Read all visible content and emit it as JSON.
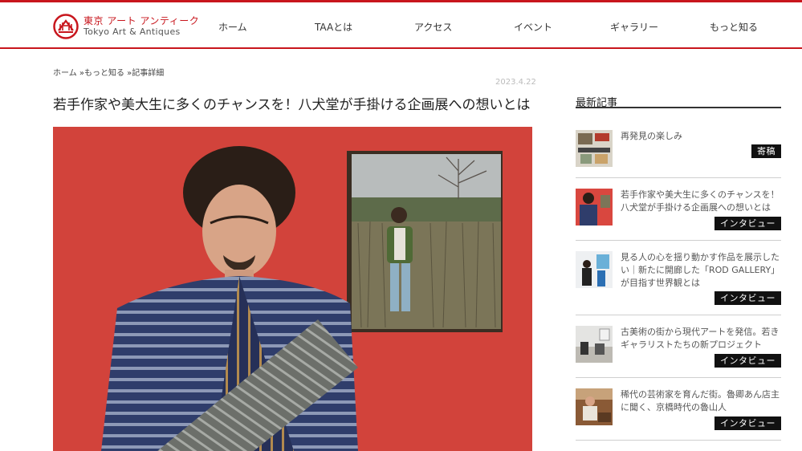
{
  "header": {
    "logo_line1": "東京 アート アンティーク",
    "logo_line2": "Tokyo Art & Antiques",
    "nav": [
      "ホーム",
      "TAAとは",
      "アクセス",
      "イベント",
      "ギャラリー",
      "もっと知る"
    ]
  },
  "breadcrumb": "ホーム »もっと知る »記事詳細",
  "article": {
    "date": "2023.4.22",
    "title": "若手作家や美大生に多くのチャンスを！八犬堂が手掛ける企画展への想いとは"
  },
  "sidebar": {
    "heading": "最新記事",
    "items": [
      {
        "title": "再発見の楽しみ",
        "badge": "寄稿"
      },
      {
        "title": "若手作家や美大生に多くのチャンスを！八犬堂が手掛ける企画展への想いとは",
        "badge": "インタビュー"
      },
      {
        "title": "見る人の心を揺り動かす作品を展示したい｜新たに開廊した「ROD GALLERY」が目指す世界観とは",
        "badge": "インタビュー"
      },
      {
        "title": "古美術の街から現代アートを発信。若きギャラリストたちの新プロジェクト",
        "badge": "インタビュー"
      },
      {
        "title": "稀代の芸術家を育んだ街。魯卿あん店主に聞く、京橋時代の魯山人",
        "badge": "インタビュー"
      }
    ]
  },
  "colors": {
    "brand": "#c8161d",
    "badge_bg": "#111111",
    "hero_wall": "#d9473f"
  }
}
